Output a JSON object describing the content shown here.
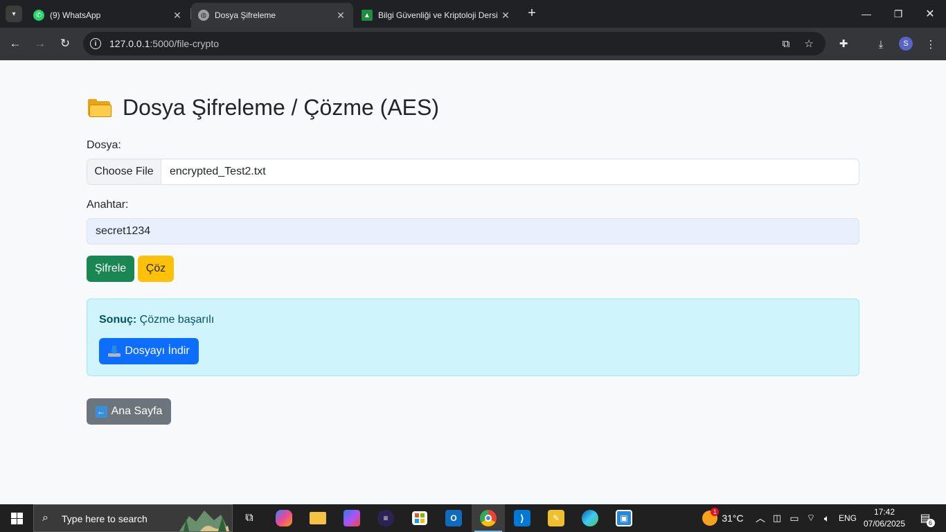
{
  "browser": {
    "tabs": [
      {
        "title": "(9) WhatsApp",
        "icon": "whatsapp-icon",
        "active": false
      },
      {
        "title": "Dosya Şifreleme",
        "icon": "globe-icon",
        "active": true
      },
      {
        "title": "Bilgi Güvenliği ve Kriptoloji Dersi",
        "icon": "classroom-icon",
        "active": false
      }
    ],
    "url_host": "127.0.0.1",
    "url_path": ":5000/file-crypto",
    "profile_initial": "S"
  },
  "page": {
    "title": "Dosya Şifreleme / Çözme (AES)",
    "file_label": "Dosya:",
    "file_button": "Choose File",
    "file_name": "encrypted_Test2.txt",
    "key_label": "Anahtar:",
    "key_value": "secret1234",
    "encrypt_button": "Şifrele",
    "decrypt_button": "Çöz",
    "result_label": "Sonuç:",
    "result_text": "Çözme başarılı",
    "download_button": "Dosyayı İndir",
    "home_button": "Ana Sayfa"
  },
  "taskbar": {
    "search_placeholder": "Type here to search",
    "weather": "31°C",
    "weather_badge": "1",
    "language": "ENG",
    "time": "17:42",
    "date": "07/06/2025",
    "notification_count": "6"
  }
}
